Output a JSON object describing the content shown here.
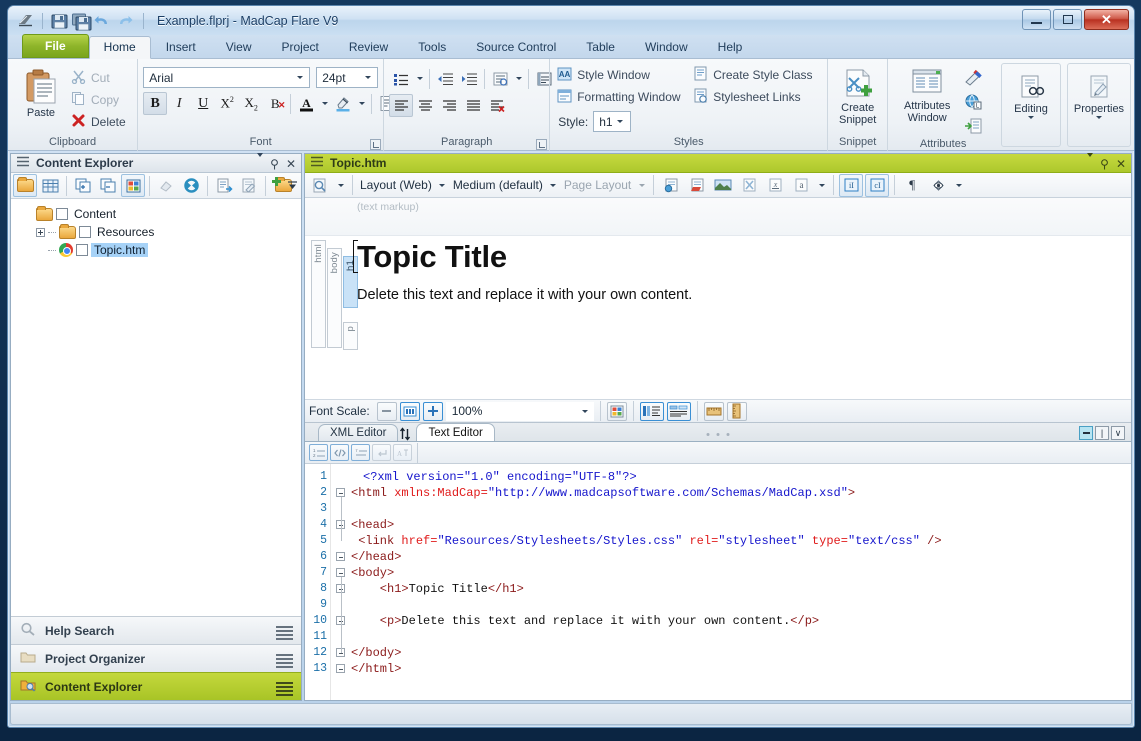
{
  "window": {
    "title": "Example.flprj - MadCap Flare V9",
    "minimize_label": "—",
    "maximize_label": "□",
    "close_label": "✕",
    "qat": [
      "save-icon",
      "save-all-icon",
      "undo-icon",
      "redo-icon"
    ]
  },
  "ribbon": {
    "tabs": [
      {
        "label": "File",
        "type": "file"
      },
      {
        "label": "Home",
        "type": "active"
      },
      {
        "label": "Insert",
        "type": "normal"
      },
      {
        "label": "View",
        "type": "normal"
      },
      {
        "label": "Project",
        "type": "normal"
      },
      {
        "label": "Review",
        "type": "normal"
      },
      {
        "label": "Tools",
        "type": "normal"
      },
      {
        "label": "Source Control",
        "type": "normal"
      },
      {
        "label": "Table",
        "type": "normal"
      },
      {
        "label": "Window",
        "type": "normal"
      },
      {
        "label": "Help",
        "type": "normal"
      }
    ],
    "clipboard": {
      "group_label": "Clipboard",
      "paste_label": "Paste",
      "cut_label": "Cut",
      "copy_label": "Copy",
      "delete_label": "Delete"
    },
    "font": {
      "group_label": "Font",
      "font_family": "Arial",
      "font_size": "24pt",
      "bold": "B",
      "italic": "I",
      "underline": "U",
      "superscript": "X²",
      "subscript": "X₂",
      "clear_format": "B",
      "text_color": "A",
      "highlight": "highlighter-icon",
      "char_style": "character-style-icon"
    },
    "paragraph": {
      "group_label": "Paragraph",
      "bullets": "bullet-list-icon",
      "decrease_indent": "decrease-indent-icon",
      "increase_indent": "increase-indent-icon",
      "line_spacing": "line-spacing-icon",
      "borders": "paragraph-borders-icon",
      "align_left": "align-left-icon",
      "align_center": "align-center-icon",
      "align_right": "align-right-icon",
      "align_justify": "align-justify-icon",
      "clear_align": "clear-alignment-icon"
    },
    "styles": {
      "group_label": "Styles",
      "style_window": "Style Window",
      "formatting_window": "Formatting Window",
      "create_style_class": "Create Style Class",
      "stylesheet_links": "Stylesheet Links",
      "style_label": "Style:",
      "style_value": "h1"
    },
    "snippet": {
      "group_label": "Snippet",
      "create_snippet": "Create\nSnippet",
      "line1": "Create",
      "line2": "Snippet"
    },
    "attributes": {
      "group_label": "Attributes",
      "line1": "Attributes",
      "line2": "Window",
      "icon1": "condition-tag-icon",
      "icon2": "language-tag-icon",
      "icon3": "insert-attribute-icon"
    },
    "editing": {
      "label": "Editing"
    },
    "properties": {
      "label": "Properties"
    }
  },
  "explorer": {
    "title": "Content Explorer",
    "toolbar": [
      "show-folders-icon",
      "show-grid-icon",
      "expand-all-icon",
      "collapse-all-icon",
      "show-icons-icon",
      "link-icon",
      "refresh-icon",
      "new-topic-icon",
      "properties-icon",
      "new-folder-icon"
    ],
    "overflow": "chevron-down-icon",
    "tree": [
      {
        "label": "Content",
        "level": 0,
        "icon": "folder-open-icon",
        "selected": false,
        "expander": false
      },
      {
        "label": "Resources",
        "level": 1,
        "icon": "folder-icon",
        "selected": false,
        "expander": true
      },
      {
        "label": "Topic.htm",
        "level": 1,
        "icon": "chrome-icon",
        "selected": true,
        "expander": false
      }
    ],
    "navbars": [
      {
        "label": "Help Search",
        "icon": "search-icon",
        "active": false
      },
      {
        "label": "Project Organizer",
        "icon": "folder-icon",
        "active": false
      },
      {
        "label": "Content Explorer",
        "icon": "content-folder-icon",
        "active": true
      }
    ]
  },
  "editor": {
    "title": "Topic.htm",
    "toolbar": {
      "preview": "preview-icon",
      "layout": "Layout (Web)",
      "medium": "Medium (default)",
      "page_layout": "Page Layout",
      "icons": [
        "insert-hyperlink-icon",
        "insert-bookmark-icon",
        "insert-image-icon",
        "insert-cross-reference-icon",
        "insert-variable-icon",
        "insert-snippet-icon",
        "show-index-icon",
        "show-concept-icon",
        "show-marks-icon",
        "show-tags-icon"
      ]
    },
    "markup_hint": "(text markup)",
    "structure_bars": [
      "html",
      "body",
      "h1",
      "p"
    ],
    "heading": "Topic Title",
    "paragraph": "Delete this text and replace it with your own content.",
    "fontscale": {
      "label": "Font Scale:",
      "decrease": "−",
      "reset": "100",
      "increase": "+",
      "zoom_value": "100%",
      "icons": [
        "color-swatch-icon",
        "structure-bars-icon",
        "tag-blocks-icon",
        "horizontal-ruler-icon",
        "vertical-ruler-icon"
      ]
    }
  },
  "texteditor": {
    "tabs": [
      {
        "label": "XML Editor",
        "active": false
      },
      {
        "label": "Text Editor",
        "active": true
      }
    ],
    "swap_icon": "swap-vertical-icon",
    "pane_controls": [
      "minimize-icon",
      "restore-icon",
      "dropdown-icon"
    ],
    "toolbar": [
      "line-numbers-icon",
      "tag-wrap-icon",
      "word-wrap-icon",
      "insert-newline-icon",
      "format-icon"
    ],
    "code_lines": [
      {
        "n": 1,
        "fold": false,
        "indent": 1,
        "parts": [
          {
            "t": "<?xml version=\"1.0\" encoding=\"UTF-8\"?>",
            "c": "c-pi"
          }
        ]
      },
      {
        "n": 2,
        "fold": true,
        "indent": 0,
        "parts": [
          {
            "t": "<html ",
            "c": "c-tag2"
          },
          {
            "t": "xmlns:MadCap=",
            "c": "c-attr"
          },
          {
            "t": "\"http://www.madcapsoftware.com/Schemas/MadCap.xsd\"",
            "c": "c-val"
          },
          {
            "t": ">",
            "c": "c-tag2"
          }
        ]
      },
      {
        "n": 3,
        "fold": false,
        "indent": 0,
        "parts": []
      },
      {
        "n": 4,
        "fold": true,
        "indent": 0,
        "parts": [
          {
            "t": "<head>",
            "c": "c-tag2"
          }
        ]
      },
      {
        "n": 5,
        "fold": false,
        "indent": 0,
        "parts": [
          {
            "t": " <link ",
            "c": "c-tag2"
          },
          {
            "t": "href=",
            "c": "c-attr"
          },
          {
            "t": "\"Resources/Stylesheets/Styles.css\"",
            "c": "c-val"
          },
          {
            "t": " rel=",
            "c": "c-attr"
          },
          {
            "t": "\"stylesheet\"",
            "c": "c-val"
          },
          {
            "t": " type=",
            "c": "c-attr"
          },
          {
            "t": "\"text/css\"",
            "c": "c-val"
          },
          {
            "t": " />",
            "c": "c-tag2"
          }
        ]
      },
      {
        "n": 6,
        "fold": true,
        "indent": 0,
        "parts": [
          {
            "t": "</head>",
            "c": "c-tag2"
          }
        ]
      },
      {
        "n": 7,
        "fold": true,
        "indent": 0,
        "parts": [
          {
            "t": "<body>",
            "c": "c-tag2"
          }
        ]
      },
      {
        "n": 8,
        "fold": true,
        "indent": 0,
        "parts": [
          {
            "t": "    <h1>",
            "c": "c-tag2"
          },
          {
            "t": "Topic Title",
            "c": "c-txt"
          },
          {
            "t": "</h1>",
            "c": "c-tag2"
          }
        ]
      },
      {
        "n": 9,
        "fold": false,
        "indent": 0,
        "parts": []
      },
      {
        "n": 10,
        "fold": true,
        "indent": 0,
        "parts": [
          {
            "t": "    <p>",
            "c": "c-tag2"
          },
          {
            "t": "Delete this text and replace it with your own content.",
            "c": "c-txt"
          },
          {
            "t": "</p>",
            "c": "c-tag2"
          }
        ]
      },
      {
        "n": 11,
        "fold": false,
        "indent": 0,
        "parts": []
      },
      {
        "n": 12,
        "fold": true,
        "indent": 0,
        "parts": [
          {
            "t": "</body>",
            "c": "c-tag2"
          }
        ]
      },
      {
        "n": 13,
        "fold": true,
        "indent": 0,
        "parts": [
          {
            "t": "</html>",
            "c": "c-tag2"
          }
        ]
      }
    ]
  },
  "colors": {
    "accent_green": "#b4cc33",
    "selection_blue": "#a6d2f7",
    "close_red": "#b93121"
  }
}
